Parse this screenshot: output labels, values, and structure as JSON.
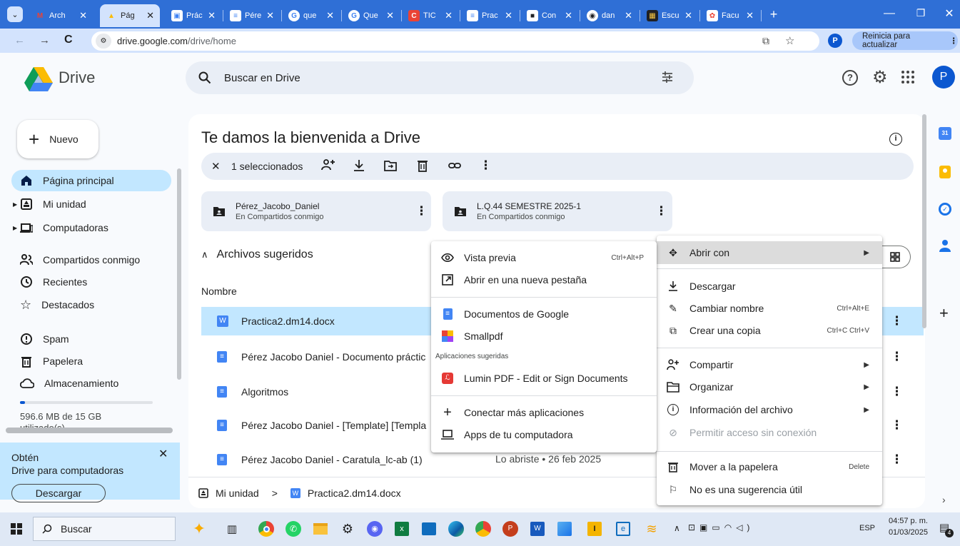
{
  "browser": {
    "tabs": [
      {
        "title": "Arch",
        "favicon_color": "#ea4335",
        "favicon_glyph": "M"
      },
      {
        "title": "Pág",
        "favicon_color": "#fbbc04",
        "favicon_glyph": "▲",
        "active": true
      },
      {
        "title": "Prác",
        "favicon_color": "#4285f4",
        "favicon_glyph": "▣"
      },
      {
        "title": "Pére",
        "favicon_color": "#4285f4",
        "favicon_glyph": "≡"
      },
      {
        "title": "que",
        "favicon_color": "#ffffff",
        "favicon_glyph": "G"
      },
      {
        "title": "Que",
        "favicon_color": "#ffffff",
        "favicon_glyph": "G"
      },
      {
        "title": "TIC",
        "favicon_color": "#ea4335",
        "favicon_glyph": "C"
      },
      {
        "title": "Prac",
        "favicon_color": "#4285f4",
        "favicon_glyph": "≡"
      },
      {
        "title": "Con",
        "favicon_color": "#202124",
        "favicon_glyph": "■"
      },
      {
        "title": "dan",
        "favicon_color": "#202124",
        "favicon_glyph": "◉"
      },
      {
        "title": "Escu",
        "favicon_color": "#202124",
        "favicon_glyph": "▦"
      },
      {
        "title": "Facu",
        "favicon_color": "#ea4335",
        "favicon_glyph": "✿"
      }
    ],
    "url": "drive.google.com/drive/home",
    "url_host": "drive.google.com",
    "url_path": "/drive/home",
    "update_button": "Reinicia para actualizar",
    "profile_initial": "P"
  },
  "drive": {
    "logo_text": "Drive",
    "search_placeholder": "Buscar en Drive",
    "avatar_initial": "P",
    "new_button": "Nuevo",
    "nav": [
      {
        "label": "Página principal",
        "icon": "home-icon",
        "active": true
      },
      {
        "label": "Mi unidad",
        "icon": "my-drive-icon"
      },
      {
        "label": "Computadoras",
        "icon": "computer-icon"
      },
      {
        "label": "Compartidos conmigo",
        "icon": "shared-icon"
      },
      {
        "label": "Recientes",
        "icon": "clock-icon"
      },
      {
        "label": "Destacados",
        "icon": "star-icon"
      },
      {
        "label": "Spam",
        "icon": "spam-icon"
      },
      {
        "label": "Papelera",
        "icon": "trash-icon"
      },
      {
        "label": "Almacenamiento",
        "icon": "cloud-icon"
      }
    ],
    "storage_text": "596.6 MB de 15 GB",
    "storage_sub": "utilizado(s)",
    "storage_fraction": 0.04,
    "promo": {
      "title": "Obtén",
      "subtitle": "Drive para computadoras",
      "button": "Descargar"
    },
    "welcome_title": "Te damos la bienvenida a Drive",
    "selection_text": "1 seleccionados",
    "folders": [
      {
        "name": "Pérez_Jacobo_Daniel",
        "sub": "En Compartidos conmigo"
      },
      {
        "name": "L.Q.44 SEMESTRE 2025-1",
        "sub": "En Compartidos conmigo"
      }
    ],
    "suggested_title": "Archivos sugeridos",
    "column_name": "Nombre",
    "files": [
      {
        "name": "Practica2.dm14.docx",
        "type": "word",
        "meta": "",
        "selected": true
      },
      {
        "name": "Pérez Jacobo Daniel - Documento práctic",
        "type": "docs",
        "meta": ""
      },
      {
        "name": "Algoritmos",
        "type": "docs",
        "meta": ""
      },
      {
        "name": "Pérez Jacobo Daniel - [Template] [Templa",
        "type": "docs",
        "meta": ""
      },
      {
        "name": "Pérez Jacobo Daniel - Caratula_lc-ab (1)",
        "type": "docs",
        "meta": "Lo abriste • 26 feb 2025"
      }
    ],
    "breadcrumb": {
      "root": "Mi unidad",
      "sep": ">",
      "file": "Practica2.dm14.docx"
    }
  },
  "context_menu": {
    "items": [
      {
        "label": "Abrir con",
        "icon": "open-with-icon",
        "arrow": "▶",
        "highlight": true
      },
      {
        "label": "Descargar",
        "icon": "download-icon"
      },
      {
        "label": "Cambiar nombre",
        "icon": "rename-icon",
        "shortcut": "Ctrl+Alt+E"
      },
      {
        "label": "Crear una copia",
        "icon": "copy-icon",
        "shortcut": "Ctrl+C Ctrl+V"
      },
      {
        "label": "Compartir",
        "icon": "share-icon",
        "arrow": "▶"
      },
      {
        "label": "Organizar",
        "icon": "folder-icon",
        "arrow": "▶"
      },
      {
        "label": "Información del archivo",
        "icon": "info-icon",
        "arrow": "▶"
      },
      {
        "label": "Permitir acceso sin conexión",
        "icon": "offline-icon",
        "disabled": true
      },
      {
        "label": "Mover a la papelera",
        "icon": "trash-icon",
        "shortcut": "Delete"
      },
      {
        "label": "No es una sugerencia útil",
        "icon": "feedback-icon"
      }
    ]
  },
  "open_with_menu": {
    "items": [
      {
        "label": "Vista previa",
        "icon": "eye-icon",
        "shortcut": "Ctrl+Alt+P"
      },
      {
        "label": "Abrir en una nueva pestaña",
        "icon": "new-tab-icon"
      },
      {
        "label": "Documentos de Google",
        "icon": "google-docs-icon"
      },
      {
        "label": "Smallpdf",
        "icon": "smallpdf-icon"
      },
      {
        "label": "Lumin PDF - Edit or Sign Documents",
        "icon": "lumin-icon"
      },
      {
        "label": "Conectar más aplicaciones",
        "icon": "plus-icon"
      },
      {
        "label": "Apps de tu computadora",
        "icon": "laptop-icon"
      }
    ],
    "section_label": "Aplicaciones sugeridas"
  },
  "taskbar": {
    "search": "Buscar",
    "lang": "ESP",
    "time": "04:57 p. m.",
    "date": "01/03/2025",
    "notification_count": "4"
  },
  "colors": {
    "accent": "#0b57d0",
    "selected_row": "#c2e7ff",
    "tabstrip": "#2f6fd6"
  }
}
